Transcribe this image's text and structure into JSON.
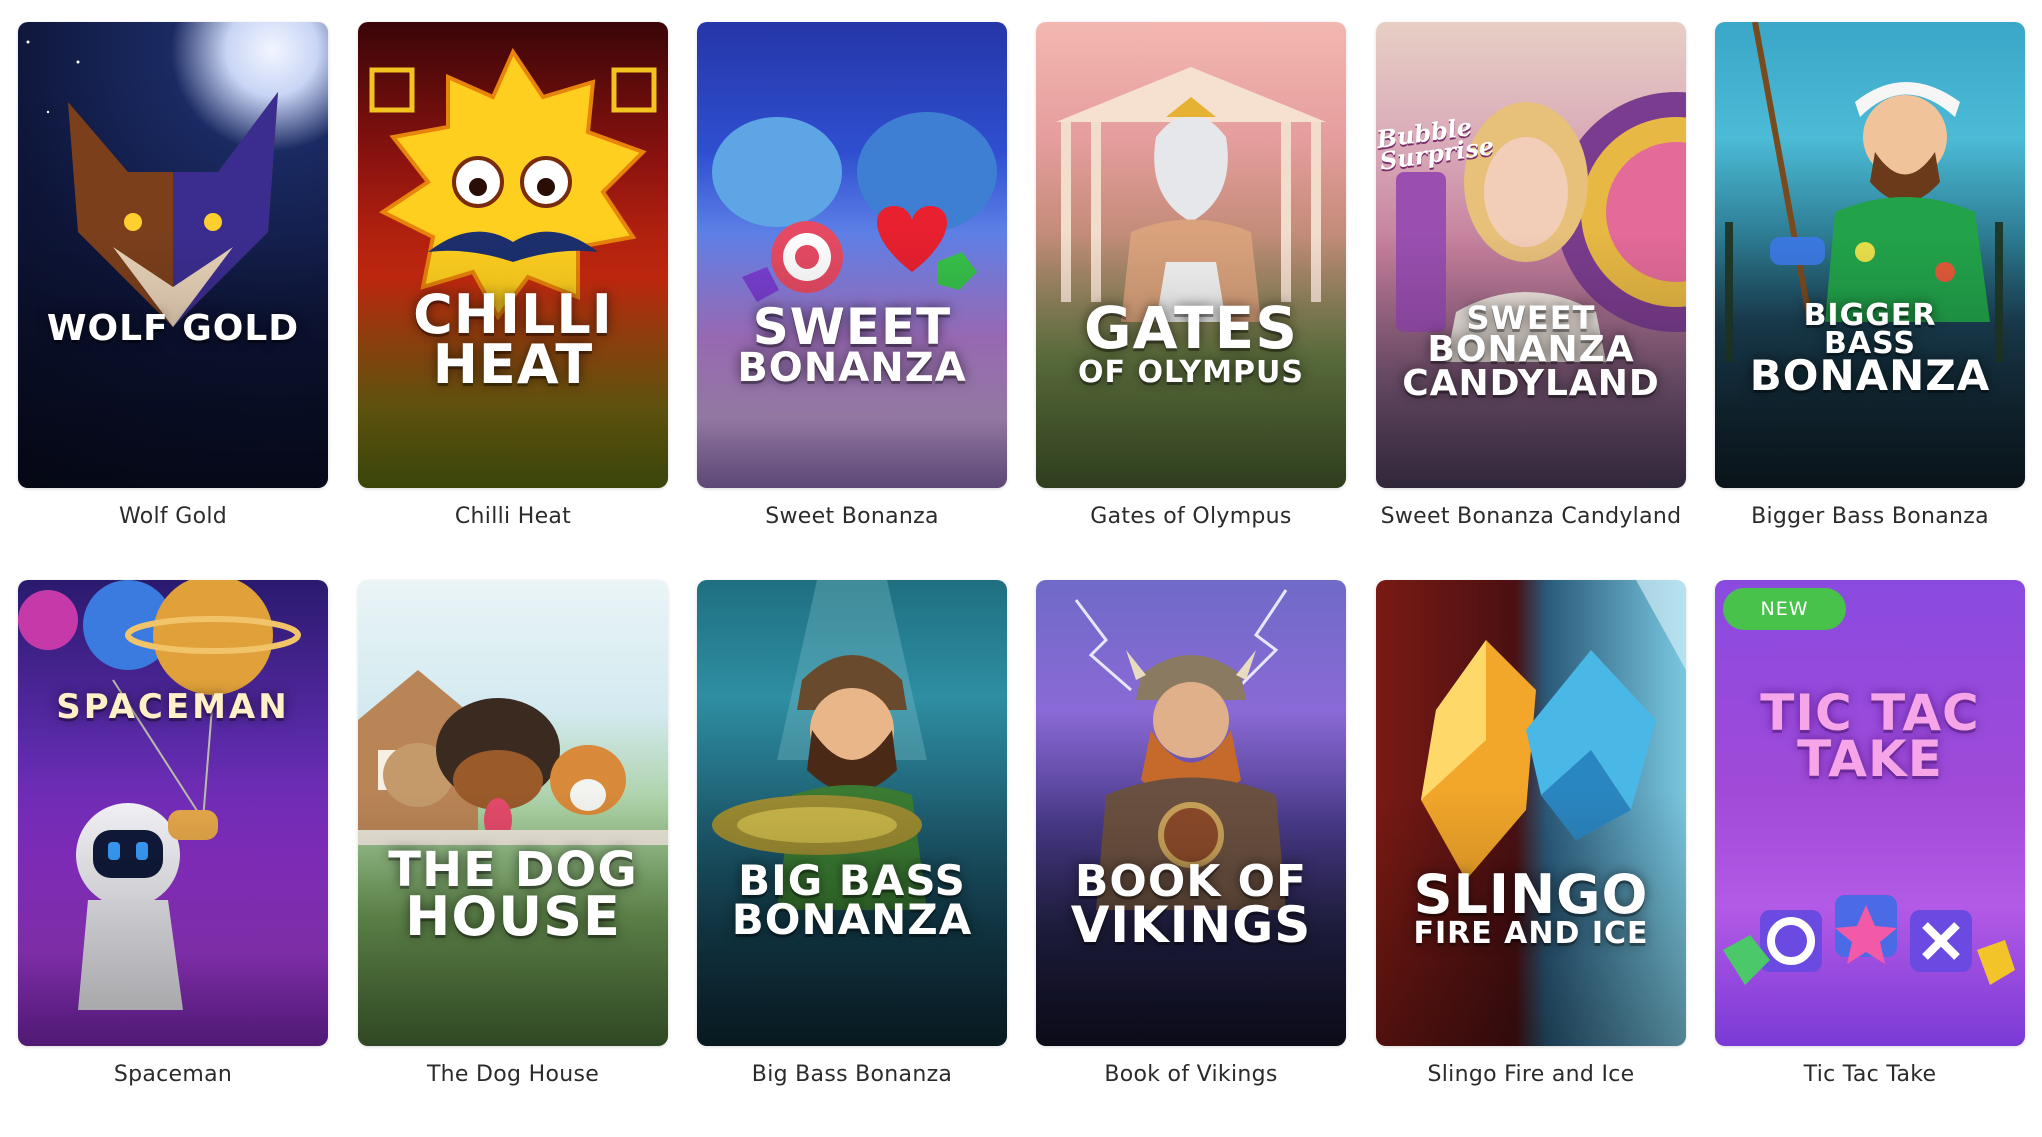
{
  "games": [
    {
      "caption": "Wolf Gold",
      "logo": [
        "WOLF GOLD"
      ]
    },
    {
      "caption": "Chilli Heat",
      "logo": [
        "CHILLI",
        "HEAT"
      ]
    },
    {
      "caption": "Sweet Bonanza",
      "logo": [
        "SWEET",
        "BONANZA"
      ]
    },
    {
      "caption": "Gates of Olympus",
      "logo": [
        "GATES",
        "OF OLYMPUS"
      ]
    },
    {
      "caption": "Sweet Bonanza Candyland",
      "logo": [
        "SWEET",
        "BONANZA",
        "CANDYLAND"
      ],
      "overlay_text": "Bubble Surprise"
    },
    {
      "caption": "Bigger Bass Bonanza",
      "logo": [
        "BIGGER",
        "BASS",
        "BONANZA"
      ]
    },
    {
      "caption": "Spaceman",
      "logo": [
        "SPACEMAN"
      ]
    },
    {
      "caption": "The Dog House",
      "logo": [
        "THE DOG",
        "HOUSE"
      ]
    },
    {
      "caption": "Big Bass Bonanza",
      "logo": [
        "BIG BASS",
        "BONANZA"
      ]
    },
    {
      "caption": "Book of Vikings",
      "logo": [
        "BOOK OF",
        "VIKINGS"
      ]
    },
    {
      "caption": "Slingo Fire and Ice",
      "logo": [
        "SLINGO",
        "FIRE AND ICE"
      ]
    },
    {
      "caption": "Tic Tac Take",
      "logo": [
        "TIC TAC",
        "TAKE"
      ],
      "badge": "NEW"
    }
  ],
  "colors": {
    "badge": "#49c24b",
    "caption_text": "#2b2b2b",
    "page_background": "#ffffff"
  }
}
